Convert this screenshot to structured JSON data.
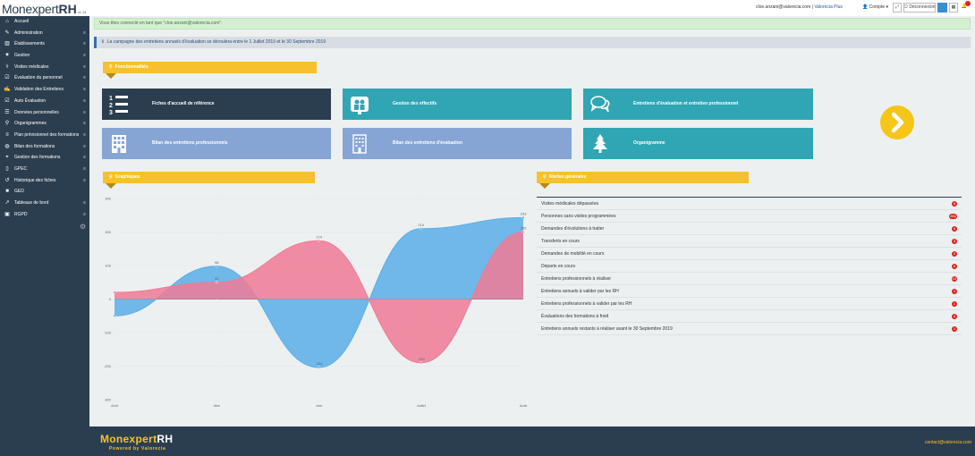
{
  "app": {
    "logo_part1": "Monexpert",
    "logo_part2": "RH",
    "version": "v1.14"
  },
  "sidebar": {
    "items": [
      {
        "label": "Accueil",
        "icon": "home-icon",
        "glyph": "⌂",
        "has_toggle": false
      },
      {
        "label": "Administration",
        "icon": "admin-icon",
        "glyph": "✎",
        "has_toggle": true
      },
      {
        "label": "Établissements",
        "icon": "building-icon",
        "glyph": "▥",
        "has_toggle": true
      },
      {
        "label": "Gestion",
        "icon": "gear-icon",
        "glyph": "✷",
        "has_toggle": true
      },
      {
        "label": "Visites médicales",
        "icon": "stethoscope-icon",
        "glyph": "⚕",
        "has_toggle": true
      },
      {
        "label": "Évaluation du personnel",
        "icon": "check-square-icon",
        "glyph": "☑",
        "has_toggle": true
      },
      {
        "label": "Validation des Entretiens",
        "icon": "edit-icon",
        "glyph": "✍",
        "has_toggle": true
      },
      {
        "label": "Auto Évaluation",
        "icon": "check-square-icon",
        "glyph": "☑",
        "has_toggle": true
      },
      {
        "label": "Données personnelles",
        "icon": "list-icon",
        "glyph": "☰",
        "has_toggle": true
      },
      {
        "label": "Organigrammes",
        "icon": "sitemap-icon",
        "glyph": "⚲",
        "has_toggle": true
      },
      {
        "label": "Plan prévisionnel des formations",
        "icon": "sliders-icon",
        "glyph": "≡",
        "has_toggle": true
      },
      {
        "label": "Bilan des formations",
        "icon": "globe-icon",
        "glyph": "◍",
        "has_toggle": true
      },
      {
        "label": "Gestion des formations",
        "icon": "graduation-cap-icon",
        "glyph": "⌖",
        "has_toggle": true
      },
      {
        "label": "GPEC",
        "icon": "mobile-icon",
        "glyph": "▯",
        "has_toggle": true
      },
      {
        "label": "Historique des fiches",
        "icon": "history-icon",
        "glyph": "↺",
        "has_toggle": true
      },
      {
        "label": "GED",
        "icon": "folder-icon",
        "glyph": "■",
        "has_toggle": false
      },
      {
        "label": "Tableaux de bord",
        "icon": "line-chart-icon",
        "glyph": "↗",
        "has_toggle": true
      },
      {
        "label": "RGPD",
        "icon": "lock-icon",
        "glyph": "▣",
        "has_toggle": true
      }
    ],
    "toggle_glyph": "≡",
    "gear_glyph": "⚙"
  },
  "topbar": {
    "user_email": "cloe.anzani@valorecia.com",
    "separator": "|",
    "organisation": "Valorecia Plus",
    "account_label": "Compte",
    "account_caret": "▾",
    "expand_glyph": "⤢",
    "logout_label": "Déconnexion",
    "grid_glyph": "▦",
    "bell_glyph": "🔔"
  },
  "alerts": {
    "success": "Vous êtes connecté en tant que \"cloe.anzani@valorecia.com\".",
    "info_glyph": "ℹ",
    "info": "La campagne des entretiens annuels d'évaluation se déroulera entre le 1 Juillet 2019 et le 30 Septembre 2019"
  },
  "sections": {
    "pin_glyph": "⚲",
    "features_title": "Fonctionnalités",
    "charts_title": "Graphiques",
    "alerts_title": "Alertes générales"
  },
  "tiles": {
    "fiches": "Fiches d'accueil de référence",
    "effectifs": "Gestion des effectifs",
    "entretiens": "Entretiens d'évaluation et entretien professionnel",
    "bilan_pro": "Bilan des entretiens professionnels",
    "bilan_eval": "Bilan des entretiens d'évaluation",
    "organigramme": "Organigramme"
  },
  "chart_data": {
    "type": "area",
    "categories": [
      "Avril",
      "Mai",
      "Juin",
      "Juillet",
      "Août"
    ],
    "ylim": [
      -300,
      300
    ],
    "yticks": [
      300,
      200,
      100,
      0,
      -100,
      -200,
      -300
    ],
    "grid": true,
    "series": [
      {
        "color": "#5aaee8",
        "values": [
          -50,
          98,
          -204,
          210,
          243
        ]
      },
      {
        "color": "#f07a95",
        "values": [
          20,
          50,
          174,
          -190,
          200
        ]
      }
    ],
    "data_labels": [
      {
        "series": 0,
        "index": 1,
        "text": "98"
      },
      {
        "series": 0,
        "index": 2,
        "text": "-204"
      },
      {
        "series": 0,
        "index": 3,
        "text": "210"
      },
      {
        "series": 0,
        "index": 4,
        "text": "243"
      },
      {
        "series": 1,
        "index": 1,
        "text": "50"
      },
      {
        "series": 1,
        "index": 2,
        "text": "174"
      },
      {
        "series": 1,
        "index": 3,
        "text": "-190"
      },
      {
        "series": 1,
        "index": 4,
        "text": "200"
      }
    ]
  },
  "general_alerts": [
    {
      "label": "Visites médicales dépassées",
      "count": "8"
    },
    {
      "label": "Personnes sans visites programmées",
      "count": "892"
    },
    {
      "label": "Demandes d'évolutions à traiter",
      "count": "5"
    },
    {
      "label": "Transferts en cours",
      "count": "3"
    },
    {
      "label": "Demandes de mobilité en cours",
      "count": "2"
    },
    {
      "label": "Départs en cours",
      "count": "6"
    },
    {
      "label": "Entretiens professionnels à réaliser",
      "count": "10"
    },
    {
      "label": "Entretiens annuels à valider par les RH",
      "count": "1"
    },
    {
      "label": "Entretiens professionnels à valider par les RH",
      "count": "1"
    },
    {
      "label": "Évaluations des formations à froid",
      "count": "5"
    },
    {
      "label": "Entretiens annuels restants à réaliser avant le 30 Septembre 2019",
      "count": "1"
    }
  ],
  "footer": {
    "logo_part1": "Monexpert",
    "logo_part2": "RH",
    "powered": "Powered by Valorecia",
    "contact": "contact@valorecia.com"
  }
}
